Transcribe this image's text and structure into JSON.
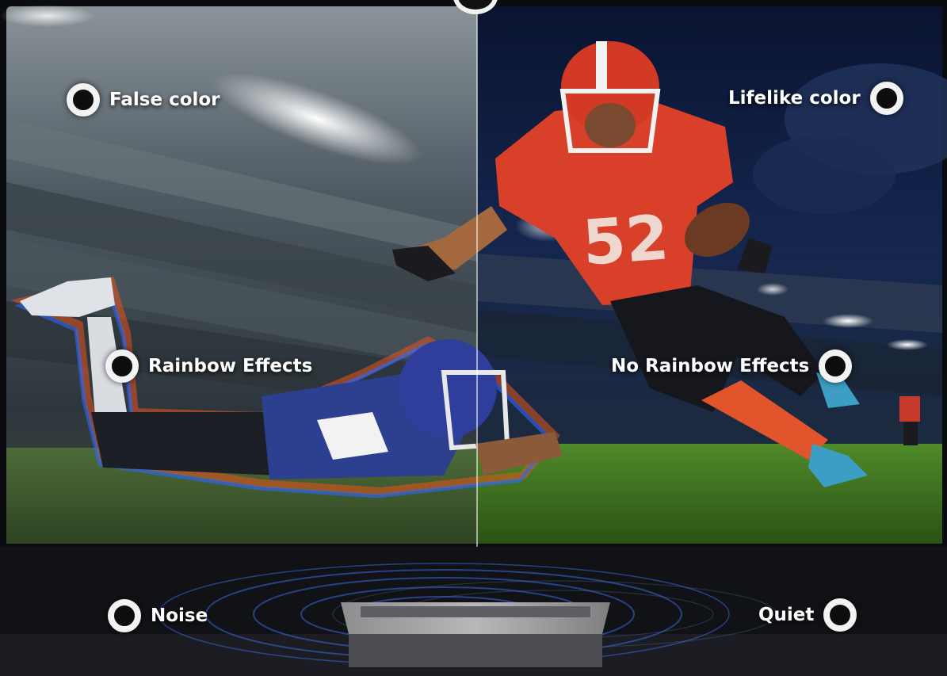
{
  "labels": {
    "false_color": "False color",
    "lifelike_color": "Lifelike color",
    "rainbow_effects": "Rainbow Effects",
    "no_rainbow_effects": "No Rainbow Effects",
    "noise": "Noise",
    "quiet": "Quiet"
  },
  "colors": {
    "left_sky": "#5d6870",
    "right_sky": "#0e1a3a",
    "grass": "#3f6d22",
    "jersey_red": "#d9402a",
    "player_blue": "#2d3f8f",
    "ring": "#f3f3f3"
  }
}
